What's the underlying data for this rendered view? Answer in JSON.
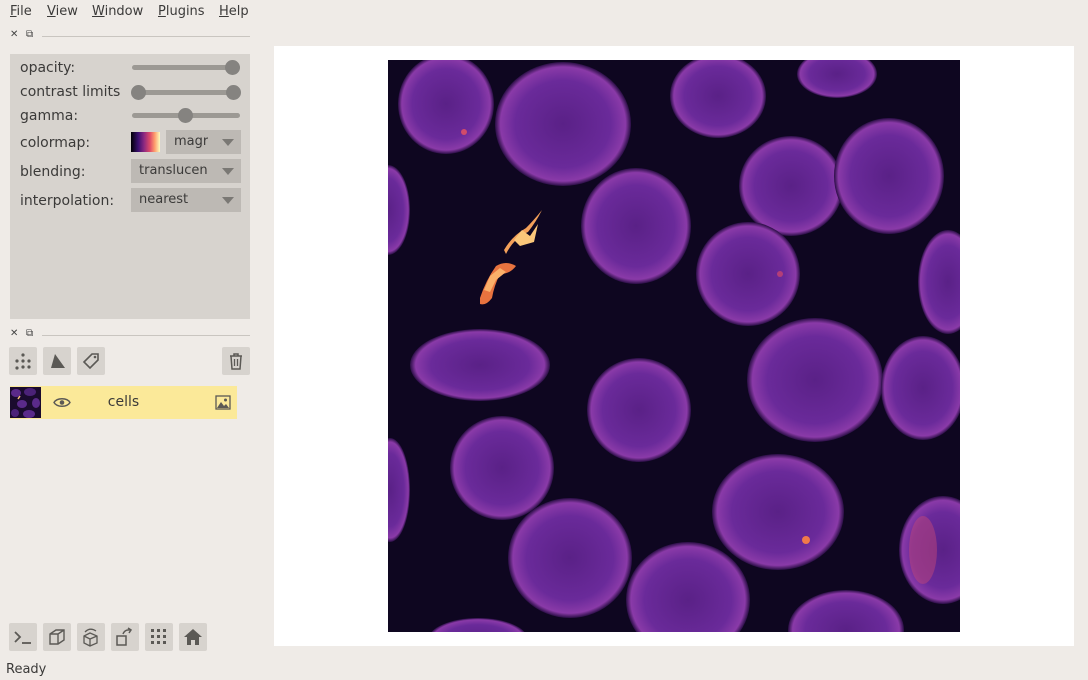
{
  "menu": [
    "File",
    "View",
    "Window",
    "Plugins",
    "Help"
  ],
  "layer_controls": {
    "opacity_label": "opacity:",
    "opacity_value": 1.0,
    "contrast_label": "contrast limits",
    "contrast_range": [
      0.0,
      1.0
    ],
    "gamma_label": "gamma:",
    "gamma_value": 0.5,
    "colormap_label": "colormap:",
    "colormap_value": "magma",
    "colormap_display": "magr",
    "blending_label": "blending:",
    "blending_value": "translucen",
    "interpolation_label": "interpolation:",
    "interpolation_value": "nearest"
  },
  "layer_buttons": [
    "new-points-icon",
    "new-shapes-icon",
    "new-labels-icon",
    "delete-icon"
  ],
  "layers": [
    {
      "name": "cells",
      "visible": true,
      "type_icon": "image-icon"
    }
  ],
  "viewer_buttons": [
    "console-icon",
    "ndisplay-icon",
    "roll-icon",
    "transpose-icon",
    "grid-icon",
    "home-icon"
  ],
  "status": "Ready"
}
